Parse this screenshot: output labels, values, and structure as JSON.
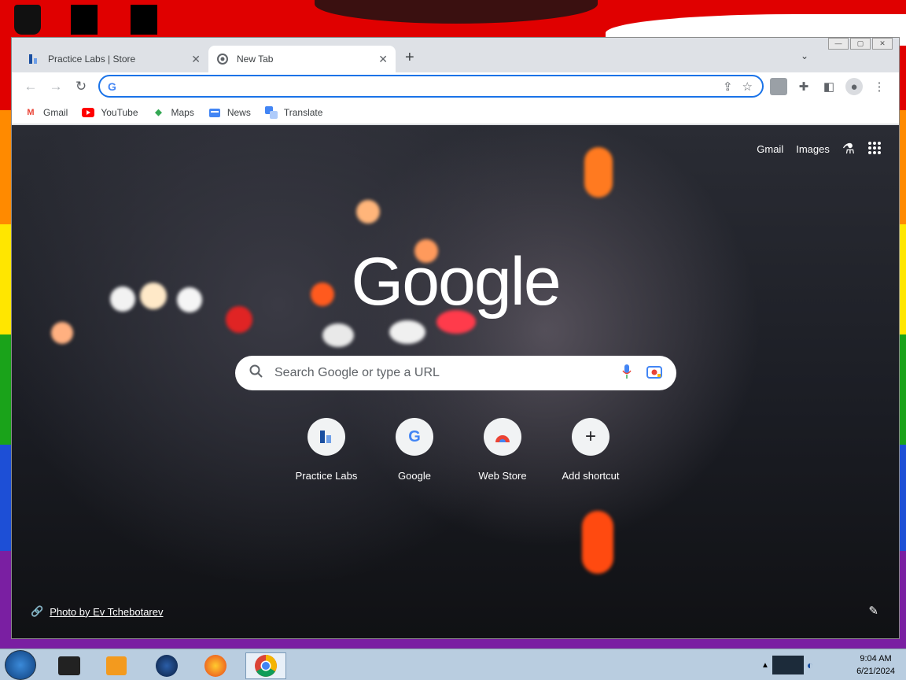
{
  "browser": {
    "tabs": [
      {
        "title": "Practice Labs | Store",
        "active": false,
        "close": "✕"
      },
      {
        "title": "New Tab",
        "active": true,
        "close": "✕"
      }
    ],
    "new_tab_symbol": "+",
    "tab_search_symbol": "⌄",
    "window_controls": [
      "—",
      "▢",
      "✕"
    ],
    "omnibox": {
      "value": "",
      "placeholder": ""
    }
  },
  "bookmarks": [
    {
      "label": "Gmail",
      "icon": "gmail-icon",
      "color": "#ea4335"
    },
    {
      "label": "YouTube",
      "icon": "youtube-icon",
      "color": "#ff0000"
    },
    {
      "label": "Maps",
      "icon": "maps-icon",
      "color": "#34a853"
    },
    {
      "label": "News",
      "icon": "news-icon",
      "color": "#4285f4"
    },
    {
      "label": "Translate",
      "icon": "translate-icon",
      "color": "#4285f4"
    }
  ],
  "newtab": {
    "top_links": {
      "gmail": "Gmail",
      "images": "Images"
    },
    "logo": "Google",
    "search_placeholder": "Search Google or type a URL",
    "shortcuts": [
      {
        "label": "Practice Labs",
        "icon": "practice-labs-icon"
      },
      {
        "label": "Google",
        "icon": "google-g-icon"
      },
      {
        "label": "Web Store",
        "icon": "web-store-icon"
      },
      {
        "label": "Add shortcut",
        "icon": "plus-icon"
      }
    ],
    "attribution": "Photo by Ev Tchebotarev"
  },
  "taskbar": {
    "time": "9:04 AM",
    "date": "6/21/2024"
  },
  "colors": {
    "accent": "#1a73e8",
    "tab_strip": "#dee1e6",
    "taskbar": "#b9cde0"
  }
}
